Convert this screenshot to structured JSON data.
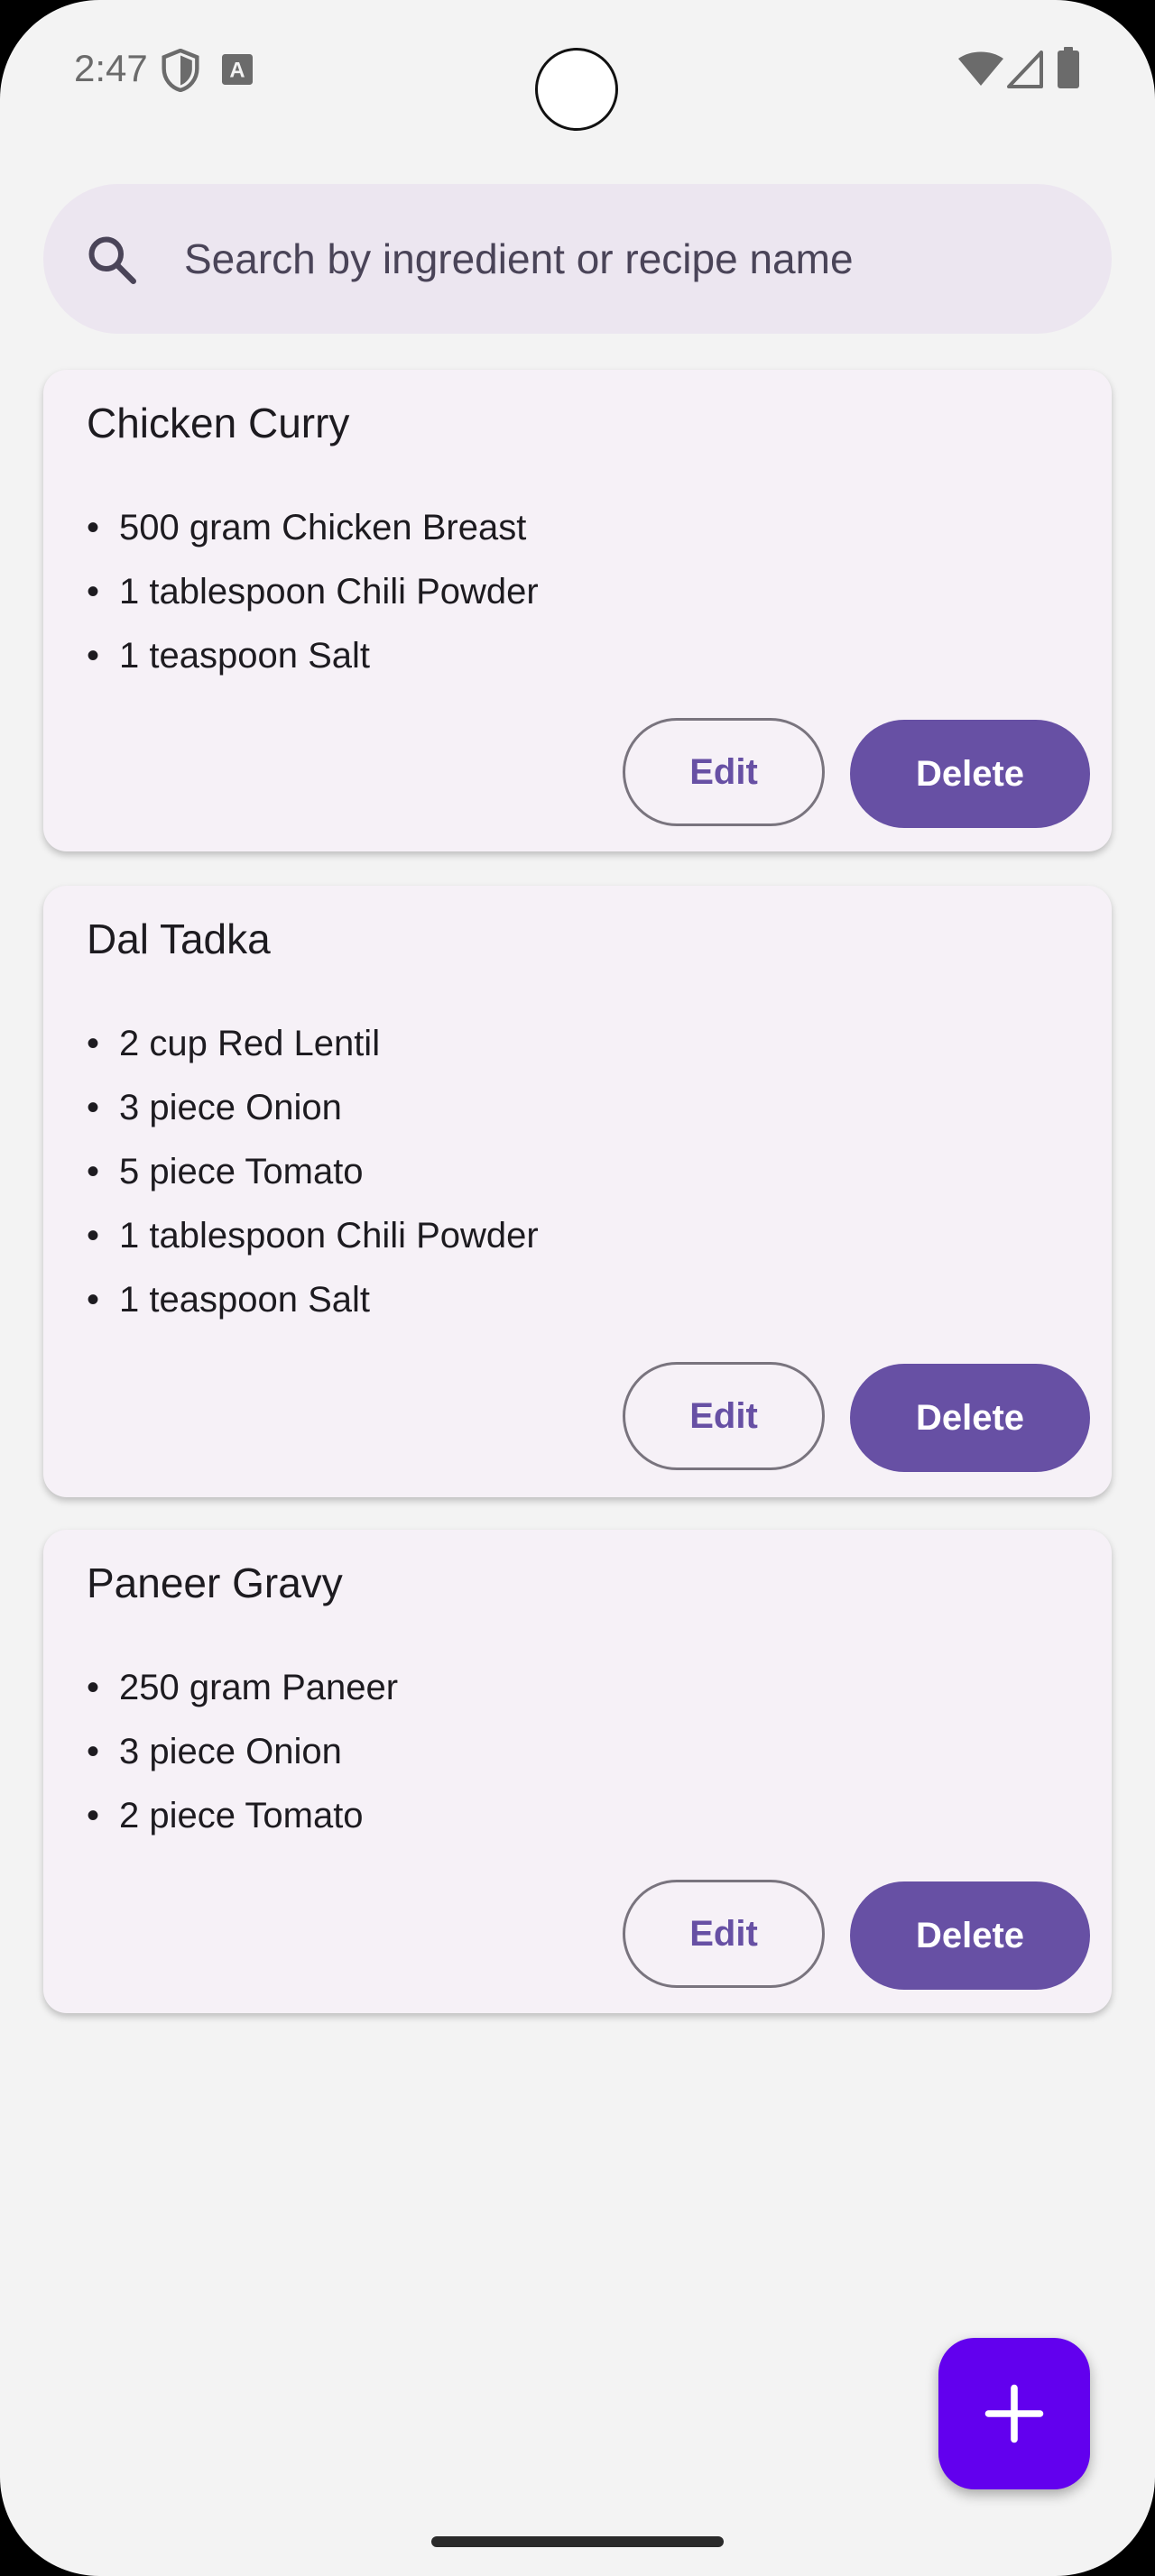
{
  "status_bar": {
    "time": "2:47",
    "icons": [
      "shield-icon",
      "keyboard-a-icon",
      "wifi-icon",
      "signal-icon",
      "battery-icon"
    ]
  },
  "search": {
    "placeholder": "Search by ingredient or recipe name",
    "icon": "search-icon"
  },
  "recipes": [
    {
      "title": "Chicken Curry",
      "ingredients": [
        "500 gram Chicken Breast",
        "1 tablespoon Chili Powder",
        "1 teaspoon Salt"
      ],
      "edit_label": "Edit",
      "delete_label": "Delete"
    },
    {
      "title": "Dal Tadka",
      "ingredients": [
        "2 cup Red Lentil",
        "3 piece Onion",
        "5 piece Tomato",
        "1 tablespoon Chili Powder",
        "1 teaspoon Salt"
      ],
      "edit_label": "Edit",
      "delete_label": "Delete"
    },
    {
      "title": "Paneer Gravy",
      "ingredients": [
        "250 gram Paneer",
        "3 piece Onion",
        "2 piece Tomato"
      ],
      "edit_label": "Edit",
      "delete_label": "Delete"
    }
  ],
  "fab": {
    "icon": "plus-icon"
  },
  "colors": {
    "primary": "#6750a4",
    "fab": "#6200ee",
    "card_bg": "#f6f1f7",
    "search_bg": "#ece6f0",
    "page_bg": "#f3f3f3"
  },
  "bullet": "•"
}
